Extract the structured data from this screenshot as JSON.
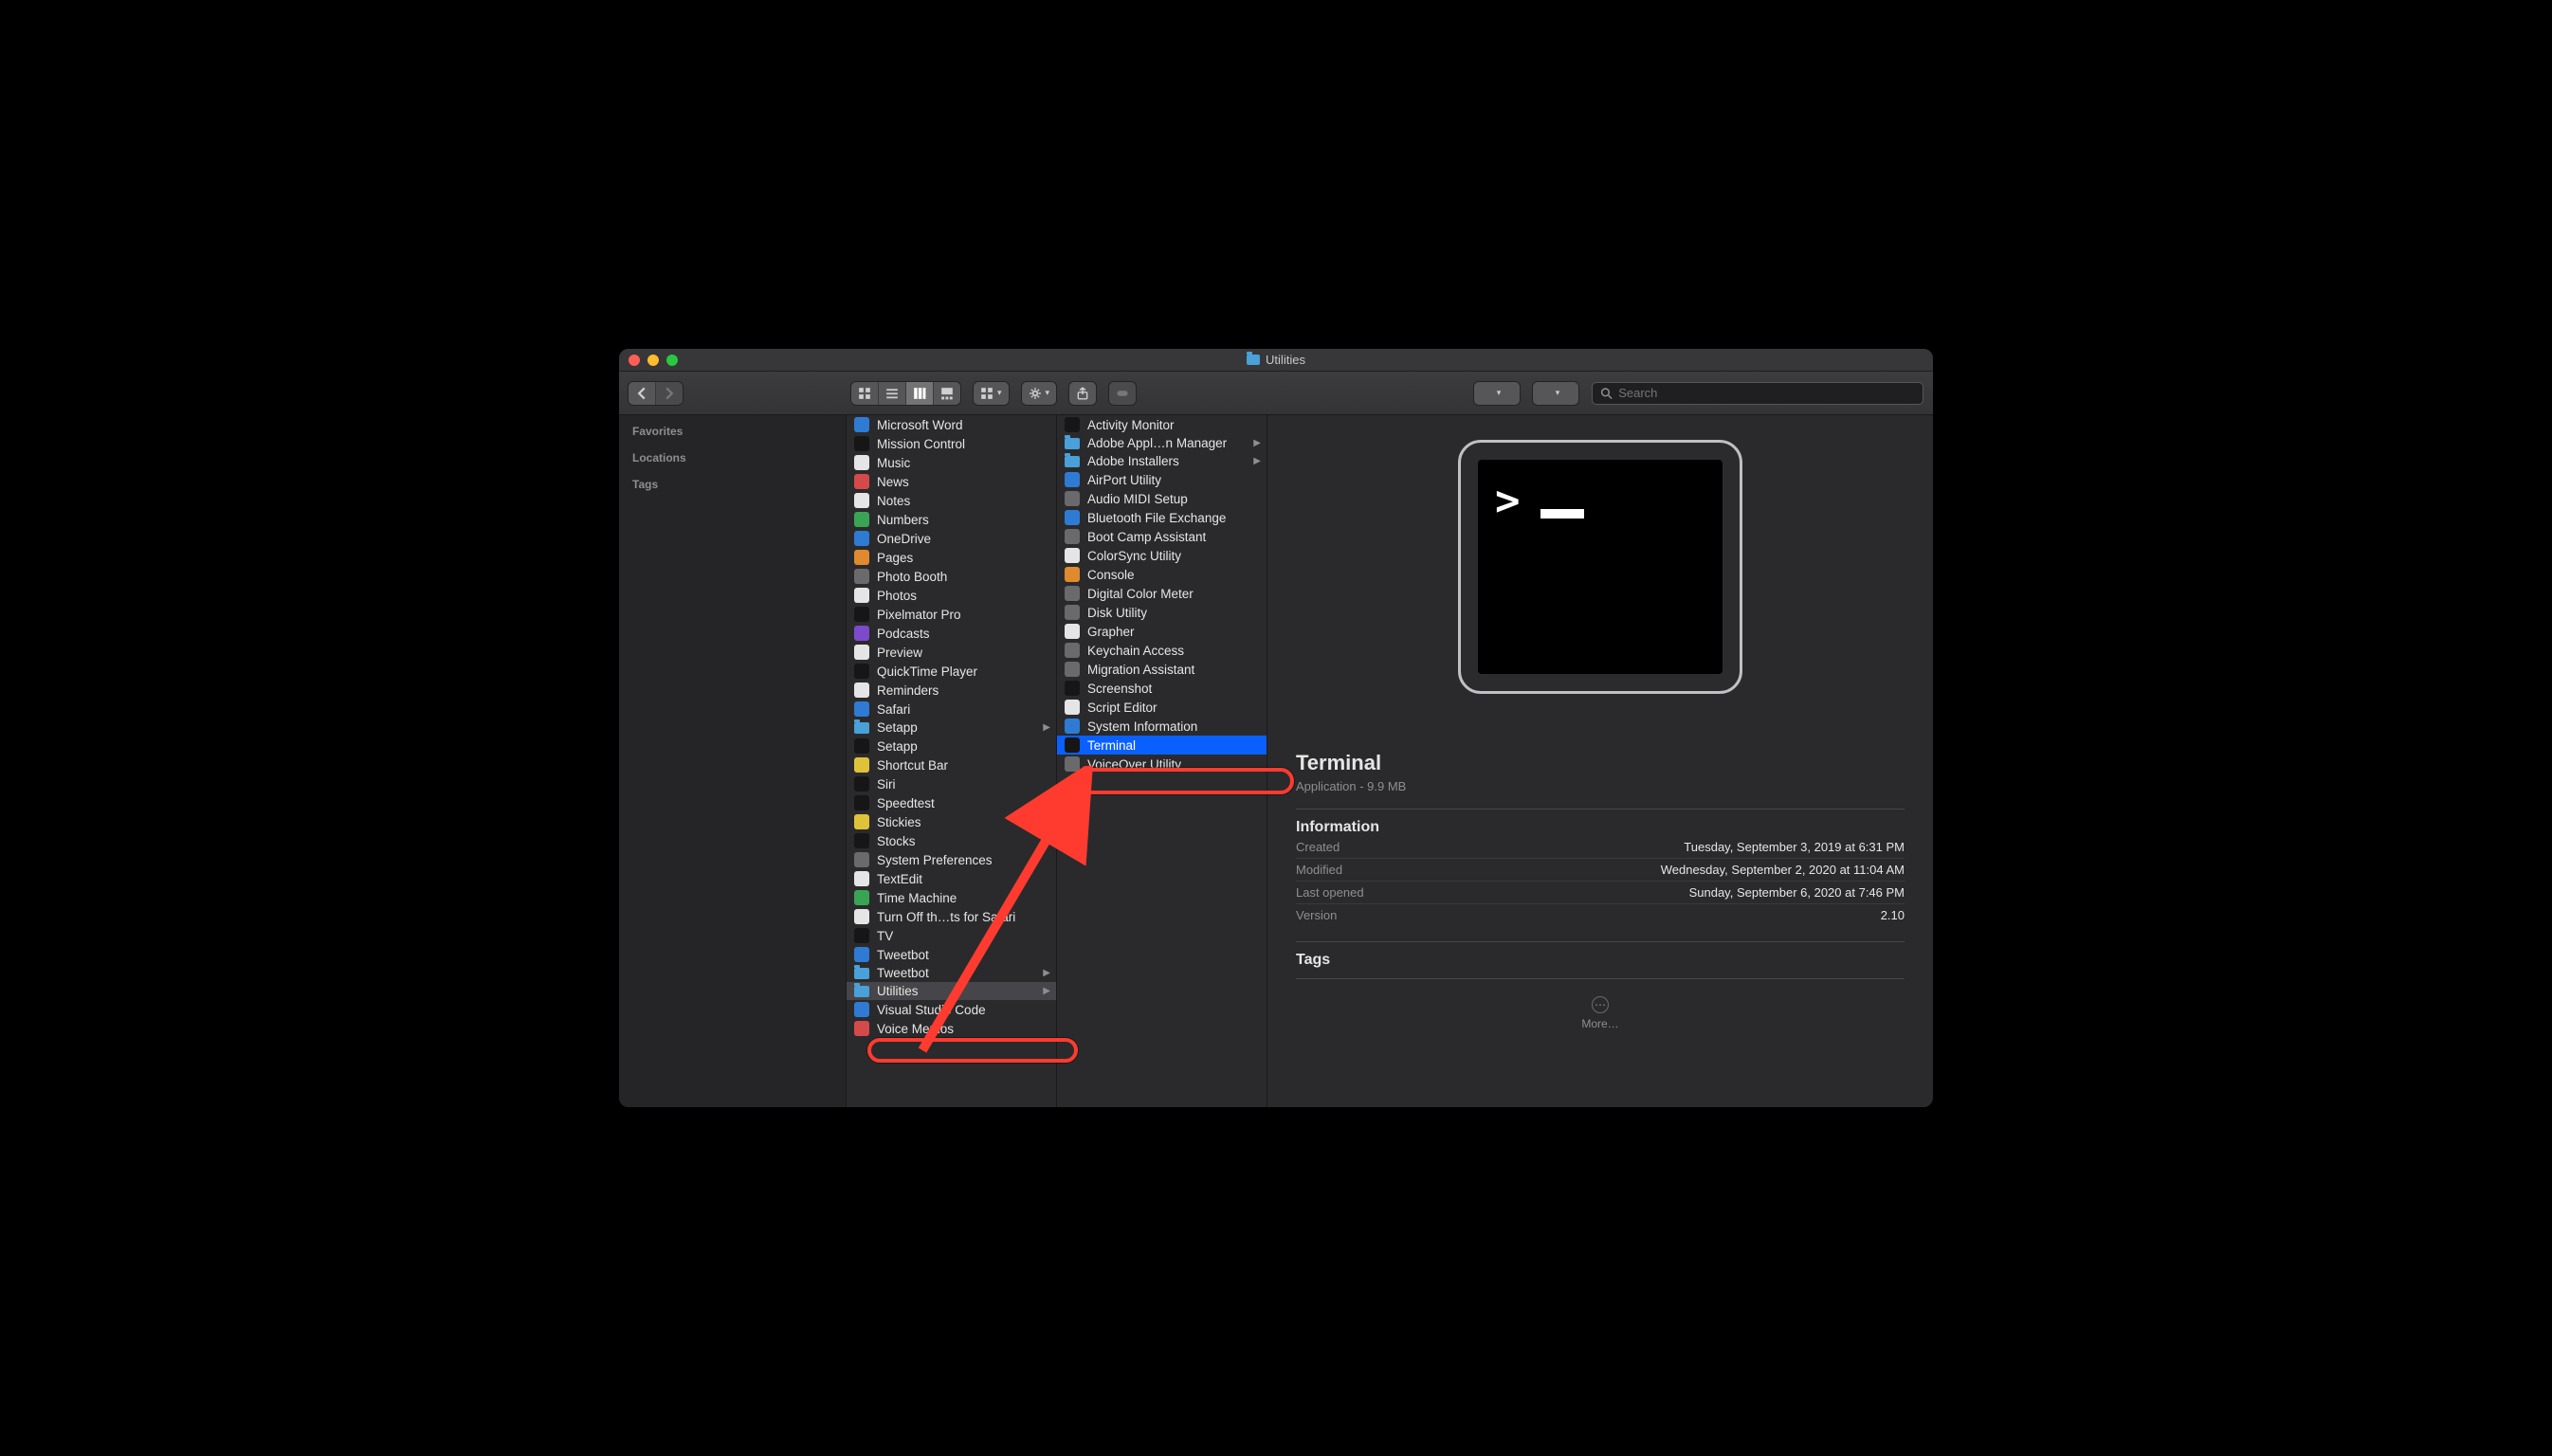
{
  "window": {
    "title": "Utilities"
  },
  "toolbar": {
    "search_placeholder": "Search"
  },
  "sidebar": {
    "headers": [
      "Favorites",
      "Locations",
      "Tags"
    ]
  },
  "col1": {
    "items": [
      {
        "label": "Microsoft Word",
        "cls": "ic-blue"
      },
      {
        "label": "Mission Control",
        "cls": "ic-black"
      },
      {
        "label": "Music",
        "cls": "ic-white"
      },
      {
        "label": "News",
        "cls": "ic-red"
      },
      {
        "label": "Notes",
        "cls": "ic-white"
      },
      {
        "label": "Numbers",
        "cls": "ic-green"
      },
      {
        "label": "OneDrive",
        "cls": "ic-blue"
      },
      {
        "label": "Pages",
        "cls": "ic-orange"
      },
      {
        "label": "Photo Booth",
        "cls": "ic-gray"
      },
      {
        "label": "Photos",
        "cls": "ic-white"
      },
      {
        "label": "Pixelmator Pro",
        "cls": "ic-black"
      },
      {
        "label": "Podcasts",
        "cls": "ic-purple"
      },
      {
        "label": "Preview",
        "cls": "ic-white"
      },
      {
        "label": "QuickTime Player",
        "cls": "ic-black"
      },
      {
        "label": "Reminders",
        "cls": "ic-white"
      },
      {
        "label": "Safari",
        "cls": "ic-blue"
      },
      {
        "label": "Setapp",
        "cls": "ic-teal",
        "folder": true,
        "arrow": true
      },
      {
        "label": "Setapp",
        "cls": "ic-black"
      },
      {
        "label": "Shortcut Bar",
        "cls": "ic-yellow"
      },
      {
        "label": "Siri",
        "cls": "ic-black"
      },
      {
        "label": "Speedtest",
        "cls": "ic-black"
      },
      {
        "label": "Stickies",
        "cls": "ic-yellow"
      },
      {
        "label": "Stocks",
        "cls": "ic-black"
      },
      {
        "label": "System Preferences",
        "cls": "ic-gray"
      },
      {
        "label": "TextEdit",
        "cls": "ic-white"
      },
      {
        "label": "Time Machine",
        "cls": "ic-green"
      },
      {
        "label": "Turn Off th…ts for Safari",
        "cls": "ic-white"
      },
      {
        "label": "TV",
        "cls": "ic-black"
      },
      {
        "label": "Tweetbot",
        "cls": "ic-blue"
      },
      {
        "label": "Tweetbot",
        "cls": "ic-teal",
        "folder": true,
        "arrow": true
      },
      {
        "label": "Utilities",
        "cls": "ic-teal",
        "folder": true,
        "arrow": true,
        "selected": "gray"
      },
      {
        "label": "Visual Studio Code",
        "cls": "ic-blue"
      },
      {
        "label": "Voice Memos",
        "cls": "ic-red"
      }
    ]
  },
  "col2": {
    "items": [
      {
        "label": "Activity Monitor",
        "cls": "ic-black"
      },
      {
        "label": "Adobe Appl…n Manager",
        "cls": "ic-teal",
        "folder": true,
        "arrow": true
      },
      {
        "label": "Adobe Installers",
        "cls": "ic-teal",
        "folder": true,
        "arrow": true
      },
      {
        "label": "AirPort Utility",
        "cls": "ic-blue"
      },
      {
        "label": "Audio MIDI Setup",
        "cls": "ic-gray"
      },
      {
        "label": "Bluetooth File Exchange",
        "cls": "ic-blue"
      },
      {
        "label": "Boot Camp Assistant",
        "cls": "ic-gray"
      },
      {
        "label": "ColorSync Utility",
        "cls": "ic-white"
      },
      {
        "label": "Console",
        "cls": "ic-orange"
      },
      {
        "label": "Digital Color Meter",
        "cls": "ic-gray"
      },
      {
        "label": "Disk Utility",
        "cls": "ic-gray"
      },
      {
        "label": "Grapher",
        "cls": "ic-white"
      },
      {
        "label": "Keychain Access",
        "cls": "ic-gray"
      },
      {
        "label": "Migration Assistant",
        "cls": "ic-gray"
      },
      {
        "label": "Screenshot",
        "cls": "ic-black"
      },
      {
        "label": "Script Editor",
        "cls": "ic-white"
      },
      {
        "label": "System Information",
        "cls": "ic-blue"
      },
      {
        "label": "Terminal",
        "cls": "ic-black",
        "selected": "blue"
      },
      {
        "label": "VoiceOver Utility",
        "cls": "ic-gray"
      }
    ]
  },
  "preview": {
    "name": "Terminal",
    "subtitle": "Application - 9.9 MB",
    "info_header": "Information",
    "rows": [
      {
        "k": "Created",
        "v": "Tuesday, September 3, 2019 at 6:31 PM"
      },
      {
        "k": "Modified",
        "v": "Wednesday, September 2, 2020 at 11:04 AM"
      },
      {
        "k": "Last opened",
        "v": "Sunday, September 6, 2020 at 7:46 PM"
      },
      {
        "k": "Version",
        "v": "2.10"
      }
    ],
    "tags_header": "Tags",
    "more_label": "More…"
  }
}
